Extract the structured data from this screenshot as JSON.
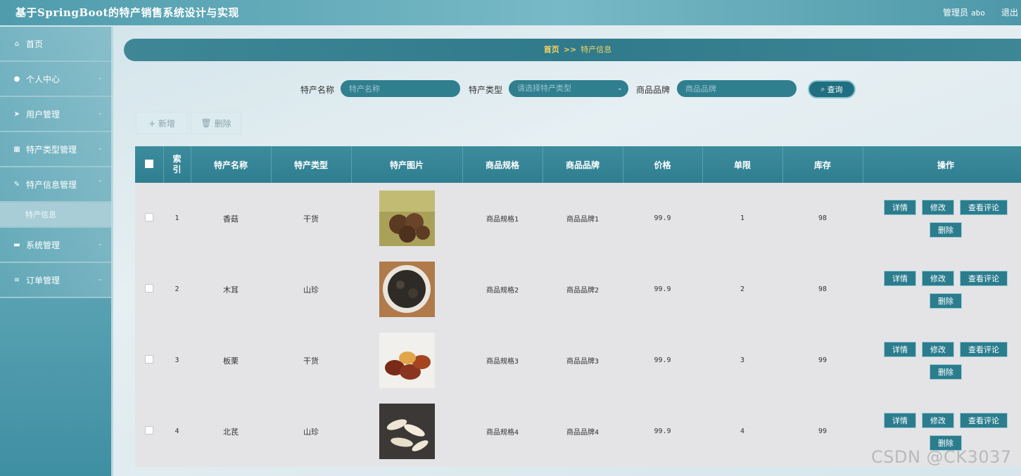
{
  "header": {
    "title": "基于SpringBoot的特产销售系统设计与实现",
    "user_role": "管理员",
    "username": "abo",
    "logout": "退出"
  },
  "sidebar": {
    "items": [
      {
        "label": "首页",
        "icon": "home-icon",
        "glyph": "⌂"
      },
      {
        "label": "个人中心",
        "icon": "user-icon",
        "glyph": "●"
      },
      {
        "label": "用户管理",
        "icon": "send-icon",
        "glyph": "➤"
      },
      {
        "label": "特产类型管理",
        "icon": "grid-icon",
        "glyph": "▦"
      },
      {
        "label": "特产信息管理",
        "icon": "thumbs-up-icon",
        "glyph": "✎"
      },
      {
        "label": "特产信息",
        "sub": true
      },
      {
        "label": "系统管理",
        "icon": "monitor-icon",
        "glyph": "▬"
      },
      {
        "label": "订单管理",
        "icon": "list-icon",
        "glyph": "≡"
      }
    ]
  },
  "breadcrumb": {
    "home": "首页",
    "separator": ">>",
    "current": "特产信息"
  },
  "search": {
    "name_label": "特产名称",
    "name_placeholder": "特产名称",
    "type_label": "特产类型",
    "type_placeholder": "请选择特产类型",
    "brand_label": "商品品牌",
    "brand_placeholder": "商品品牌",
    "query_button": "查询"
  },
  "toolbar": {
    "add_label": "+ 新增",
    "delete_label": "删除"
  },
  "table": {
    "columns": [
      "索引",
      "特产名称",
      "特产类型",
      "特产图片",
      "商品规格",
      "商品品牌",
      "价格",
      "单限",
      "库存",
      "操作"
    ],
    "rows": [
      {
        "index": "1",
        "name": "香菇",
        "type": "干货",
        "spec": "商品规格1",
        "brand": "商品品牌1",
        "price": "99.9",
        "limit": "1",
        "stock": "98"
      },
      {
        "index": "2",
        "name": "木耳",
        "type": "山珍",
        "spec": "商品规格2",
        "brand": "商品品牌2",
        "price": "99.9",
        "limit": "2",
        "stock": "98"
      },
      {
        "index": "3",
        "name": "板栗",
        "type": "干货",
        "spec": "商品规格3",
        "brand": "商品品牌3",
        "price": "99.9",
        "limit": "3",
        "stock": "99"
      },
      {
        "index": "4",
        "name": "北芪",
        "type": "山珍",
        "spec": "商品规格4",
        "brand": "商品品牌4",
        "price": "99.9",
        "limit": "4",
        "stock": "99"
      }
    ],
    "actions": {
      "detail": "详情",
      "edit": "修改",
      "reviews": "查看评论",
      "delete": "删除"
    }
  },
  "watermark": "CSDN @CK3037",
  "colors": {
    "accent": "#2f7f8f",
    "header": "#4f9cad",
    "highlight": "#f6d365"
  }
}
